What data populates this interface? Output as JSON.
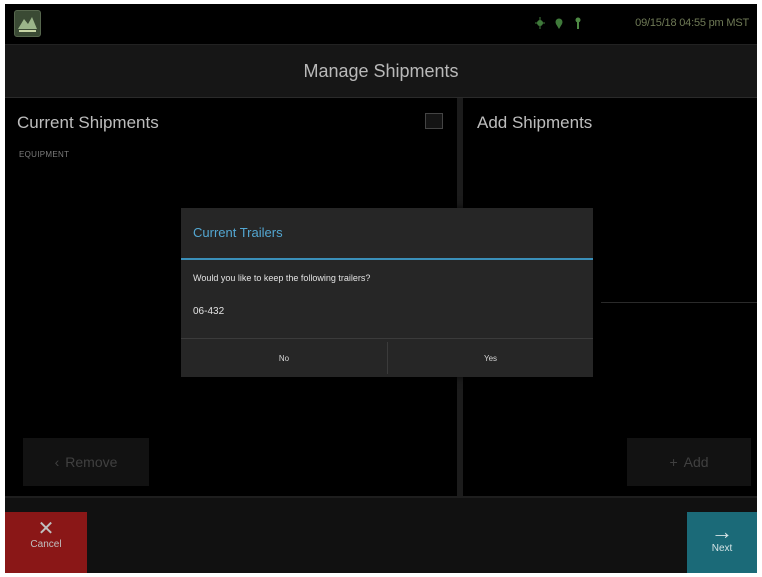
{
  "statusbar": {
    "time": "09/15/18 04:55 pm MST",
    "icons": [
      "gps-icon",
      "location-icon",
      "signal-icon"
    ]
  },
  "header": {
    "title": "Manage Shipments"
  },
  "left_pane": {
    "title": "Current Shipments",
    "label": "EQUIPMENT",
    "remove_label": "Remove"
  },
  "right_pane": {
    "title": "Add Shipments",
    "add_label": "Add"
  },
  "bottombar": {
    "cancel_label": "Cancel",
    "next_label": "Next"
  },
  "dialog": {
    "title": "Current Trailers",
    "message": "Would you like to keep the following trailers?",
    "trailer": "06-432",
    "no_label": "No",
    "yes_label": "Yes"
  },
  "colors": {
    "accent": "#3a8fb9",
    "cancel": "#8a1717",
    "next": "#1b6a78"
  }
}
